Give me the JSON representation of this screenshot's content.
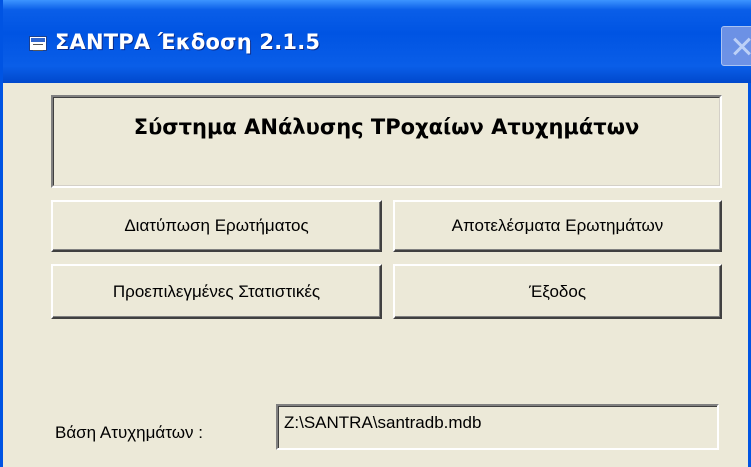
{
  "window": {
    "title": "ΣΑΝΤΡΑ Έκδοση 2.1.5",
    "icon": "access-form-icon",
    "accent_color": "#0054e3",
    "background_color": "#ece9d8"
  },
  "header": {
    "system_name": "Σύστημα ΑΝάλυσης ΤΡοχαίων Ατυχημάτων"
  },
  "buttons": {
    "query_design": "Διατύπωση Ερωτήματος",
    "query_results": "Αποτελέσματα Ερωτημάτων",
    "predefined_stats": "Προεπιλεγμένες Στατιστικές",
    "exit": "Έξοδος"
  },
  "database": {
    "label": "Βάση Ατυχημάτων :",
    "path": "Z:\\SANTRA\\santradb.mdb"
  }
}
